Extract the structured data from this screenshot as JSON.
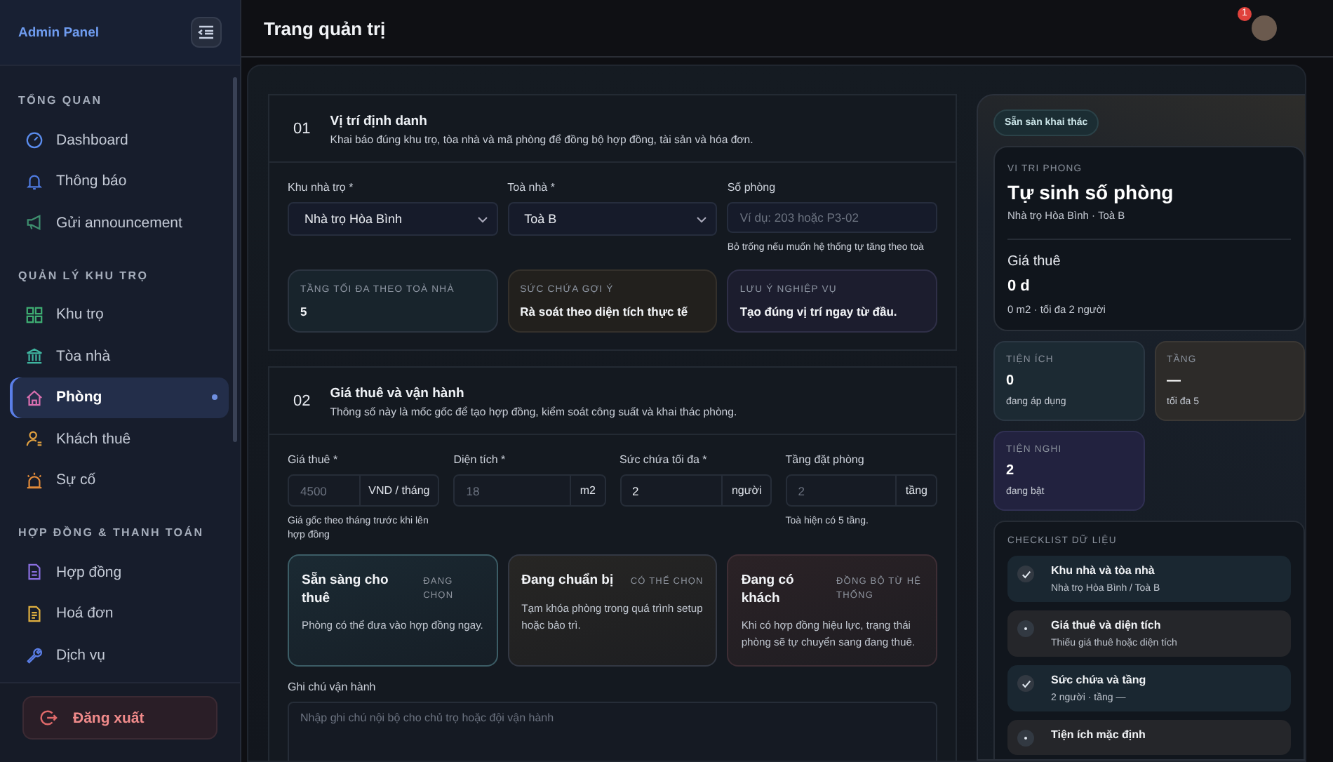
{
  "sidebar": {
    "brand": "Admin Panel",
    "sections": [
      {
        "title": "TỔNG QUAN",
        "items": [
          {
            "label": "Dashboard",
            "selected": false
          },
          {
            "label": "Thông báo",
            "selected": false
          },
          {
            "label": "Gửi announcement",
            "selected": false
          }
        ]
      },
      {
        "title": "QUẢN LÝ KHU TRỌ",
        "items": [
          {
            "label": "Khu trọ",
            "selected": false
          },
          {
            "label": "Tòa nhà",
            "selected": false
          },
          {
            "label": "Phòng",
            "selected": true
          },
          {
            "label": "Khách thuê",
            "selected": false
          },
          {
            "label": "Sự cố",
            "selected": false
          }
        ]
      },
      {
        "title": "HỢP ĐỒNG & THANH TOÁN",
        "items": [
          {
            "label": "Hợp đồng",
            "selected": false
          },
          {
            "label": "Hoá đơn",
            "selected": false
          },
          {
            "label": "Dịch vụ",
            "selected": false
          }
        ]
      }
    ],
    "logout": "Đăng xuất"
  },
  "header": {
    "title": "Trang quản trị",
    "notification_count": "1"
  },
  "section_1": {
    "number": "01",
    "title": "Vị trí định danh",
    "description": "Khai báo đúng khu trọ, tòa nhà và mã phòng để đồng bộ hợp đồng, tài sản và hóa đơn.",
    "fields": [
      {
        "label": "Khu nhà trọ *",
        "kind": "select",
        "value": "Nhà trọ Hòa Bình"
      },
      {
        "label": "Toà nhà *",
        "kind": "select",
        "value": "Toà B"
      },
      {
        "label": "Số phòng",
        "kind": "input",
        "placeholder": "Ví dụ: 203 hoặc P3-02",
        "hint": "Bỏ trống nếu muốn hệ thống tự tăng theo toà"
      }
    ],
    "info_cards": [
      {
        "label": "TẦNG TỐI ĐA THEO TOÀ NHÀ",
        "value": "5"
      },
      {
        "label": "SỨC CHỨA GỢI Ý",
        "value": "Rà soát theo diện tích thực tế"
      },
      {
        "label": "LƯU Ý NGHIỆP VỤ",
        "value": "Tạo đúng vị trí ngay từ đầu."
      }
    ]
  },
  "section_2": {
    "number": "02",
    "title": "Giá thuê và vận hành",
    "description": "Thông số này là mốc gốc để tạo hợp đồng, kiểm soát công suất và khai thác phòng.",
    "fields": [
      {
        "label": "Giá thuê *",
        "placeholder": "4500",
        "unit": "VND / tháng",
        "hint": "Giá gốc theo tháng trước khi lên hợp đồng"
      },
      {
        "label": "Diện tích *",
        "placeholder": "18",
        "unit": "m2"
      },
      {
        "label": "Sức chứa tối đa *",
        "value": "2",
        "unit": "người"
      },
      {
        "label": "Tầng đặt phòng",
        "placeholder": "2",
        "unit": "tầng",
        "hint": "Toà hiện có 5 tầng."
      }
    ],
    "status_options": [
      {
        "title": "Sẵn sàng cho thuê",
        "tag": "ĐANG CHỌN",
        "description": "Phòng có thể đưa vào hợp đồng ngay.",
        "selected": true
      },
      {
        "title": "Đang chuẩn bị",
        "tag": "CÓ THỂ CHỌN",
        "description": "Tạm khóa phòng trong quá trình setup hoặc bảo trì.",
        "selected": false
      },
      {
        "title": "Đang có khách",
        "tag": "ĐỒNG BỘ TỪ HỆ THỐNG",
        "description": "Khi có hợp đồng hiệu lực, trạng thái phòng sẽ tự chuyển sang đang thuê.",
        "selected": false
      }
    ],
    "note": {
      "label": "Ghi chú vận hành",
      "placeholder": "Nhập ghi chú nội bộ cho chủ trọ hoặc đội vận hành"
    }
  },
  "preview": {
    "status_badge": "Sẵn sàn khai thác",
    "position_label": "VI TRI PHONG",
    "room_title": "Tự sinh số phòng",
    "location": "Nhà trọ Hòa Bình · Toà B",
    "price_label": "Giá thuê",
    "price": "0 d",
    "details": "0 m2 · tối đa 2 người",
    "stats": [
      {
        "label": "TIỆN ÍCH",
        "value": "0",
        "note": "đang áp dụng"
      },
      {
        "label": "TẦNG",
        "value": "—",
        "note": "tối đa 5"
      },
      {
        "label": "TIỆN NGHI",
        "value": "2",
        "note": "đang bật"
      }
    ],
    "checklist": {
      "title": "CHECKLIST DỮ LIỆU",
      "items": [
        {
          "title": "Khu nhà và tòa nhà",
          "detail": "Nhà trọ Hòa Bình / Toà B",
          "done": true
        },
        {
          "title": "Giá thuê và diện tích",
          "detail": "Thiếu giá thuê hoặc diện tích",
          "done": false
        },
        {
          "title": "Sức chứa và tầng",
          "detail": "2 người · tầng —",
          "done": true
        },
        {
          "title": "Tiện ích mặc định",
          "done": false
        }
      ]
    }
  }
}
